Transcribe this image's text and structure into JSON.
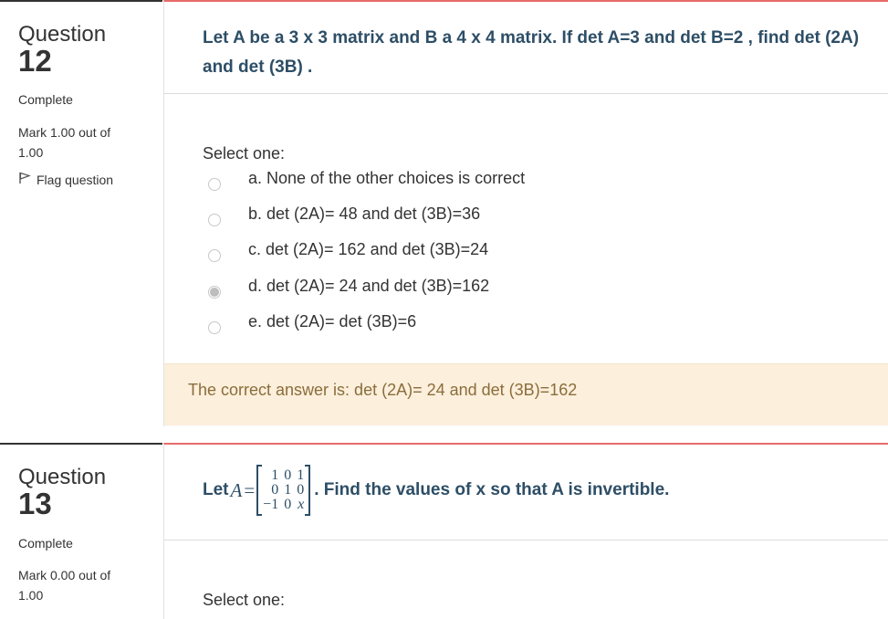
{
  "q12": {
    "question_word": "Question",
    "number": "12",
    "state": "Complete",
    "grade": "Mark 1.00 out of 1.00",
    "flag_label": "Flag question",
    "text": "Let A be a 3 x 3 matrix and B a 4 x 4 matrix. If det A=3 and det B=2 , find det (2A) and det (3B) .",
    "select_prompt": "Select one:",
    "options": [
      {
        "label": "a. None of the other choices is correct",
        "selected": false
      },
      {
        "label": "b. det (2A)= 48 and det (3B)=36",
        "selected": false
      },
      {
        "label": "c. det (2A)= 162 and det (3B)=24",
        "selected": false
      },
      {
        "label": "d. det (2A)= 24 and det (3B)=162",
        "selected": true
      },
      {
        "label": "e. det (2A)= det (3B)=6",
        "selected": false
      }
    ],
    "feedback": "The correct answer is: det (2A)= 24 and det (3B)=162"
  },
  "q13": {
    "question_word": "Question",
    "number": "13",
    "state": "Complete",
    "grade": "Mark 0.00 out of 1.00",
    "text_let": "Let",
    "math_var": "A",
    "math_eq": "=",
    "matrix": [
      [
        "1",
        "0",
        "1"
      ],
      [
        "0",
        "1",
        "0"
      ],
      [
        "−1",
        "0",
        "x"
      ]
    ],
    "text_after": ". Find the values of x so that A is invertible.",
    "select_prompt": "Select one:"
  },
  "colors": {
    "question_text": "#2d4e66",
    "content_top_border": "#e86a6a",
    "feedback_bg": "#fcefdc",
    "feedback_text": "#8a6d3b"
  }
}
